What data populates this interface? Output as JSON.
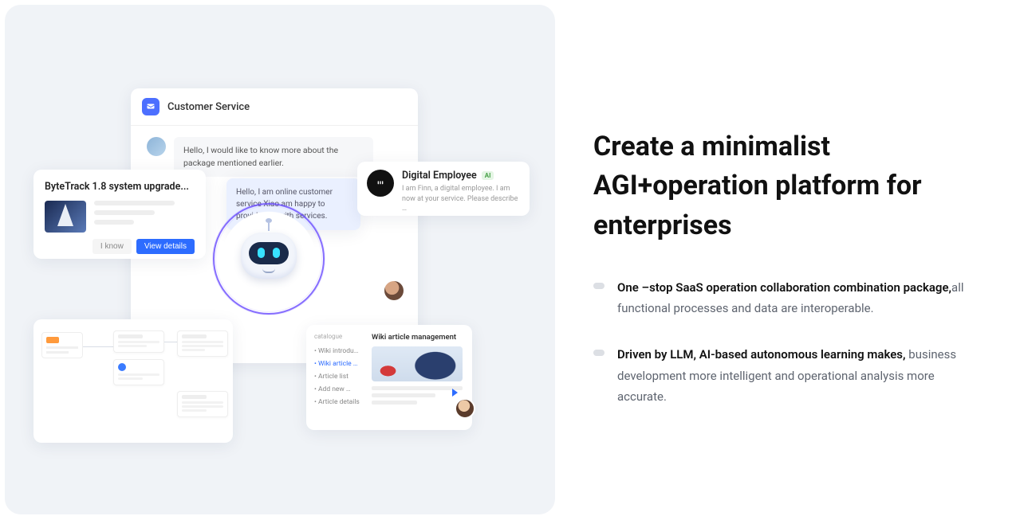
{
  "headline": "Create a minimalist AGI+operation platform for enterprises",
  "bullets": [
    {
      "bold": "One –stop SaaS operation collaboration combination package,",
      "rest": "all functional processes and data are interoperable."
    },
    {
      "bold": "Driven by LLM, AI-based autonomous learning makes,",
      "rest": "business development more intelligent and operational analysis more accurate."
    }
  ],
  "customer_service": {
    "title": "Customer Service",
    "user_msg": "Hello, I would like to know more about the package mentioned earlier.",
    "bot_reply": "Hello, I am online customer service Xiao am happy to provide you with services."
  },
  "bytetrack": {
    "title": "ByteTrack 1.8 system upgrade...",
    "know_btn": "I know",
    "view_btn": "View details"
  },
  "digital_employee": {
    "title": "Digital Employee",
    "badge": "AI",
    "desc": "I am Finn, a digital employee. I am now at your service. Please describe …"
  },
  "wiki": {
    "catalogue_label": "catalogue",
    "items": [
      "Wiki introdu…",
      "Wiki article …",
      "Article list",
      "Add new …",
      "Article details"
    ],
    "active_index": 1,
    "main_title": "Wiki article management"
  }
}
